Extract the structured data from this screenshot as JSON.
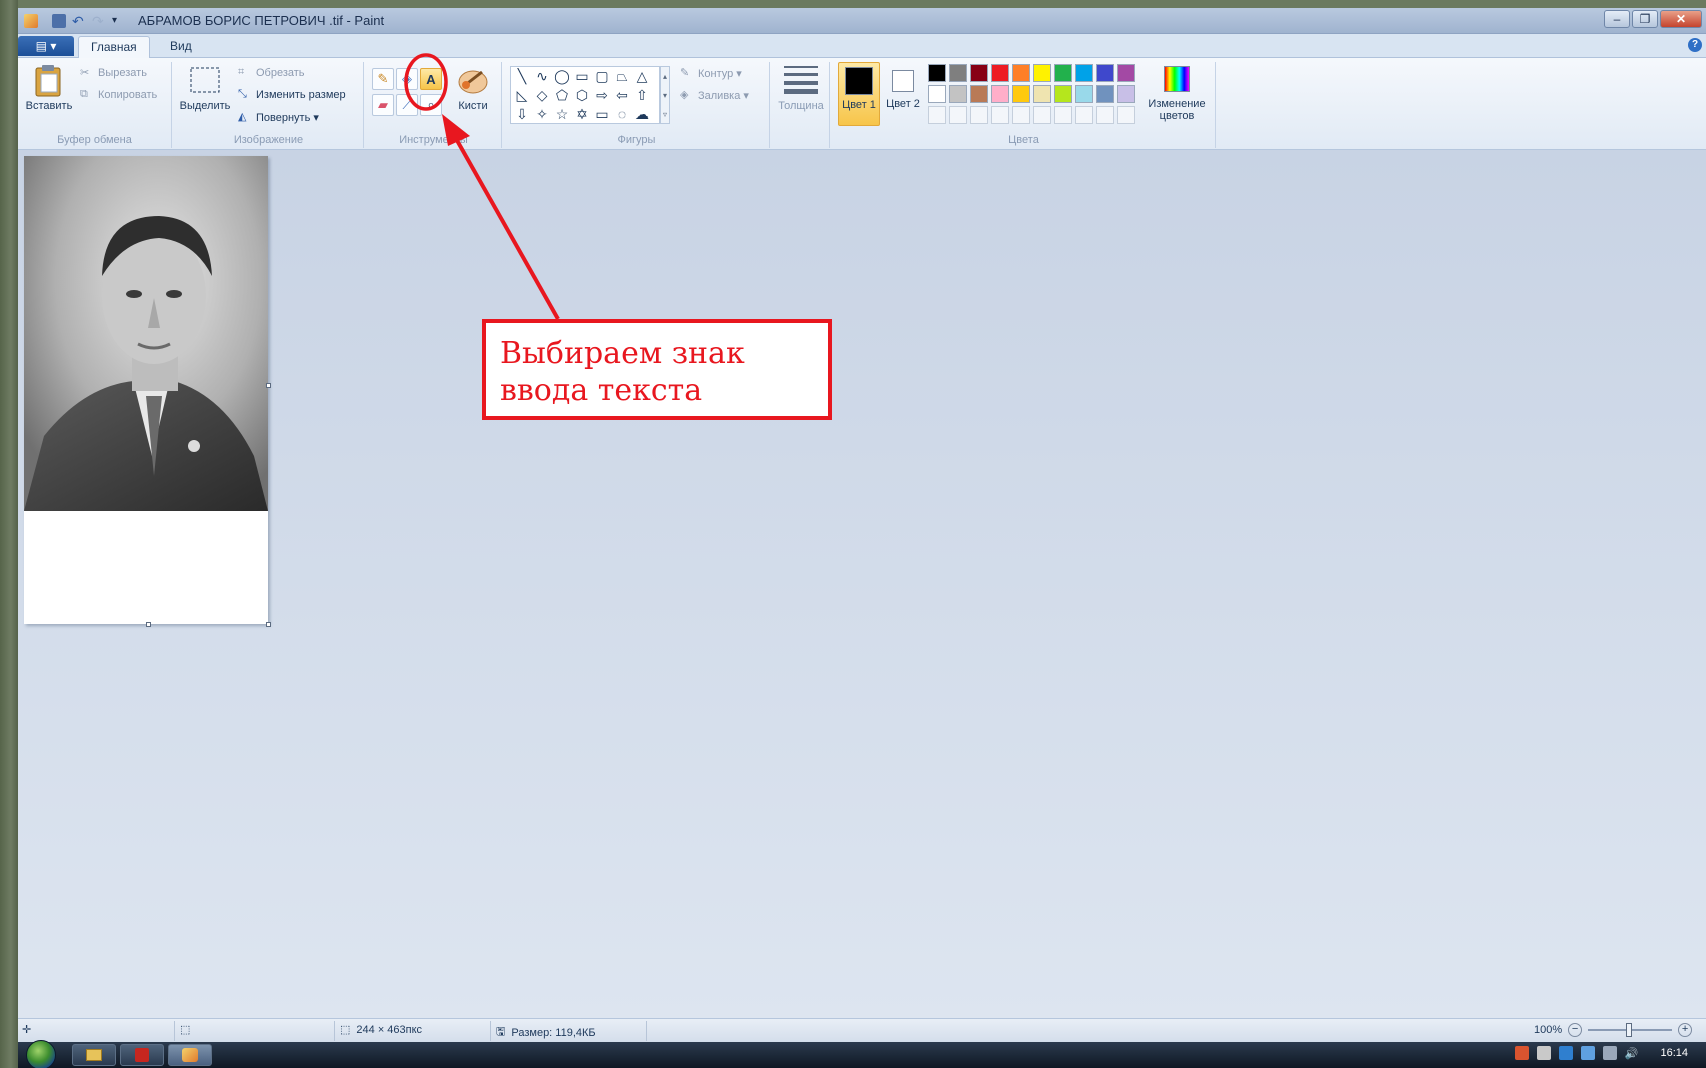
{
  "window": {
    "title": "АБРАМОВ БОРИС ПЕТРОВИЧ .tif - Paint",
    "minimize": "–",
    "maximize": "❐",
    "close": "✕"
  },
  "tabs": {
    "app_menu": "▤ ▾",
    "home": "Главная",
    "view": "Вид",
    "help": "?"
  },
  "clipboard": {
    "label": "Буфер обмена",
    "paste": "Вставить",
    "cut": "Вырезать",
    "copy": "Копировать"
  },
  "image_group": {
    "label": "Изображение",
    "select": "Выделить",
    "crop": "Обрезать",
    "resize": "Изменить размер",
    "rotate": "Повернуть ▾"
  },
  "tools": {
    "label": "Инструменты",
    "text_tool": "A",
    "brushes": "Кисти"
  },
  "shapes": {
    "label": "Фигуры",
    "outline": "Контур ▾",
    "fill": "Заливка ▾"
  },
  "size": {
    "label": "Толщина"
  },
  "colors": {
    "label": "Цвета",
    "color1": "Цвет 1",
    "color2": "Цвет 2",
    "edit": "Изменение цветов",
    "palette_row1": [
      "#000000",
      "#7f7f7f",
      "#880015",
      "#ed1c24",
      "#ff7f27",
      "#fff200",
      "#22b14c",
      "#00a2e8",
      "#3f48cc",
      "#a349a4"
    ],
    "palette_row2": [
      "#ffffff",
      "#c3c3c3",
      "#b97a57",
      "#ffaec9",
      "#ffc90e",
      "#efe4b0",
      "#b5e61d",
      "#99d9ea",
      "#7092be",
      "#c8bfe7"
    ]
  },
  "callout": {
    "line1": "Выбираем знак",
    "line2": "ввода текста",
    "color": "#e8171f"
  },
  "status": {
    "dimensions": "244 × 463пкс",
    "size": "Размер: 119,4КБ",
    "zoom": "100%"
  },
  "taskbar": {
    "clock": "16:14"
  }
}
